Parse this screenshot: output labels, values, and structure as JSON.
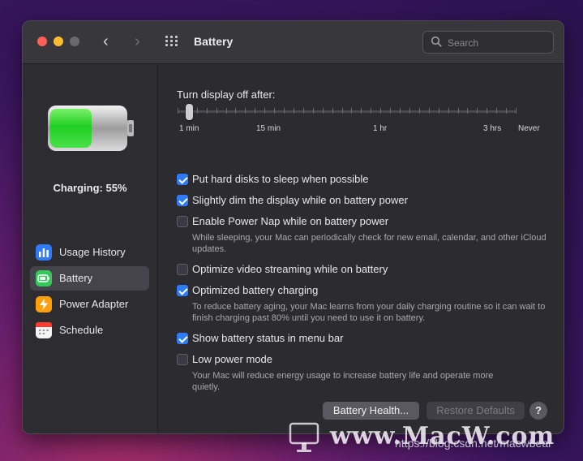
{
  "window": {
    "title": "Battery",
    "nav_back": "‹",
    "nav_forward": "›",
    "search_placeholder": "Search"
  },
  "sidebar": {
    "status": "Charging: 55%",
    "battery_level": 0.55,
    "items": [
      {
        "label": "Usage History",
        "icon": "bar-chart-icon",
        "color": "#2f7bf5"
      },
      {
        "label": "Battery",
        "icon": "battery-icon",
        "color": "#34c759",
        "active": true
      },
      {
        "label": "Power Adapter",
        "icon": "lightning-icon",
        "color": "#ff9f0a"
      },
      {
        "label": "Schedule",
        "icon": "calendar-icon",
        "color": "#ff3b30"
      }
    ]
  },
  "display_off": {
    "label": "Turn display off after:",
    "value": "1 min",
    "ticks": [
      "1 min",
      "15 min",
      "1 hr",
      "3 hrs",
      "Never"
    ]
  },
  "options": [
    {
      "label": "Put hard disks to sleep when possible",
      "checked": true,
      "desc": ""
    },
    {
      "label": "Slightly dim the display while on battery power",
      "checked": true,
      "desc": ""
    },
    {
      "label": "Enable Power Nap while on battery power",
      "checked": false,
      "desc": "While sleeping, your Mac can periodically check for new email, calendar, and other iCloud updates."
    },
    {
      "label": "Optimize video streaming while on battery",
      "checked": false,
      "desc": ""
    },
    {
      "label": "Optimized battery charging",
      "checked": true,
      "desc": "To reduce battery aging, your Mac learns from your daily charging routine so it can wait to finish charging past 80% until you need to use it on battery."
    },
    {
      "label": "Show battery status in menu bar",
      "checked": true,
      "desc": ""
    },
    {
      "label": "Low power mode",
      "checked": false,
      "desc": "Your Mac will reduce energy usage to increase battery life and operate more quietly."
    }
  ],
  "buttons": {
    "battery_health": "Battery Health...",
    "restore_defaults": "Restore Defaults",
    "help": "?"
  },
  "watermark": {
    "brand": "www.MacW.com",
    "url": "https://blog.csdn.net/macwbear"
  },
  "colors": {
    "accent": "#2f7bf5",
    "battery_green": "#34c759"
  }
}
